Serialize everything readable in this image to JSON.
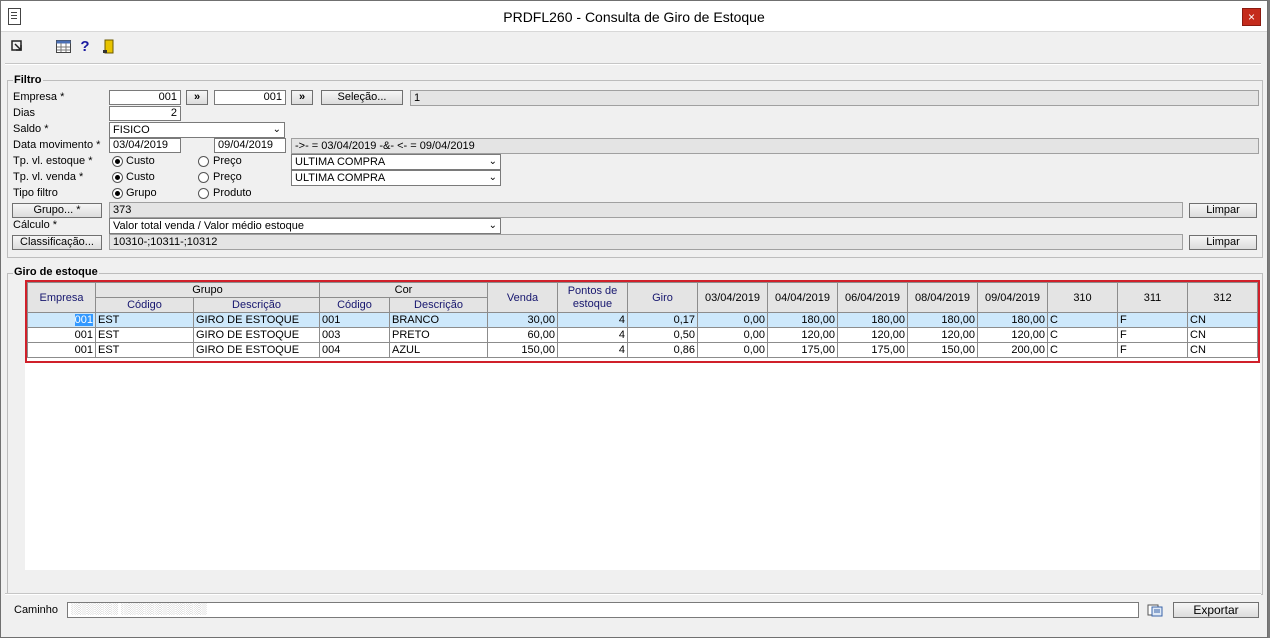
{
  "window": {
    "title": "PRDFL260 - Consulta de Giro de Estoque",
    "close": "×"
  },
  "filter": {
    "title": "Filtro",
    "empresa_label": "Empresa *",
    "empresa_from": "001",
    "empresa_to": "001",
    "range_btn": "»",
    "selecao_btn": "Seleção...",
    "selecao_value": "1",
    "dias_label": "Dias",
    "dias_value": "2",
    "saldo_label": "Saldo *",
    "saldo_value": "FISICO",
    "data_label": "Data movimento *",
    "data_from": "03/04/2019",
    "data_to": "09/04/2019",
    "data_expr": "->- = 03/04/2019 -&- <- = 09/04/2019",
    "tp_estoque_label": "Tp. vl. estoque *",
    "tp_venda_label": "Tp. vl. venda *",
    "custo": "Custo",
    "preco": "Preço",
    "tp_estoque_select": "ULTIMA COMPRA",
    "tp_venda_select": "ULTIMA COMPRA",
    "tipo_filtro_label": "Tipo filtro",
    "grupo_opt": "Grupo",
    "produto_opt": "Produto",
    "grupo_btn": "Grupo... *",
    "grupo_value": "373",
    "limpar": "Limpar",
    "calculo_label": "Cálculo *",
    "calculo_value": "Valor total venda / Valor médio estoque",
    "classif_btn": "Classificação...",
    "classif_value": "10310-;10311-;10312"
  },
  "giro": {
    "title": "Giro de estoque",
    "headers": {
      "empresa": "Empresa",
      "grupo": "Grupo",
      "cor": "Cor",
      "codigo": "Código",
      "descricao": "Descrição",
      "venda": "Venda",
      "pontos": "Pontos de",
      "estoque": "estoque",
      "giro": "Giro",
      "d1": "03/04/2019",
      "d2": "04/04/2019",
      "d3": "06/04/2019",
      "d4": "08/04/2019",
      "d5": "09/04/2019",
      "c310": "310",
      "c311": "311",
      "c312": "312"
    },
    "rows": [
      {
        "empresa": "001",
        "grupo_cod": "EST",
        "grupo_desc": "GIRO DE ESTOQUE",
        "cor_cod": "001",
        "cor_desc": "BRANCO",
        "venda": "30,00",
        "pontos": "4",
        "giro": "0,17",
        "d1": "0,00",
        "d2": "180,00",
        "d3": "180,00",
        "d4": "180,00",
        "d5": "180,00",
        "c310": "C",
        "c311": "F",
        "c312": "CN"
      },
      {
        "empresa": "001",
        "grupo_cod": "EST",
        "grupo_desc": "GIRO DE ESTOQUE",
        "cor_cod": "003",
        "cor_desc": "PRETO",
        "venda": "60,00",
        "pontos": "4",
        "giro": "0,50",
        "d1": "0,00",
        "d2": "120,00",
        "d3": "120,00",
        "d4": "120,00",
        "d5": "120,00",
        "c310": "C",
        "c311": "F",
        "c312": "CN"
      },
      {
        "empresa": "001",
        "grupo_cod": "EST",
        "grupo_desc": "GIRO DE ESTOQUE",
        "cor_cod": "004",
        "cor_desc": "AZUL",
        "venda": "150,00",
        "pontos": "4",
        "giro": "0,86",
        "d1": "0,00",
        "d2": "175,00",
        "d3": "175,00",
        "d4": "150,00",
        "d5": "200,00",
        "c310": "C",
        "c311": "F",
        "c312": "CN"
      }
    ]
  },
  "footer": {
    "caminho_label": "Caminho",
    "exportar": "Exportar"
  }
}
